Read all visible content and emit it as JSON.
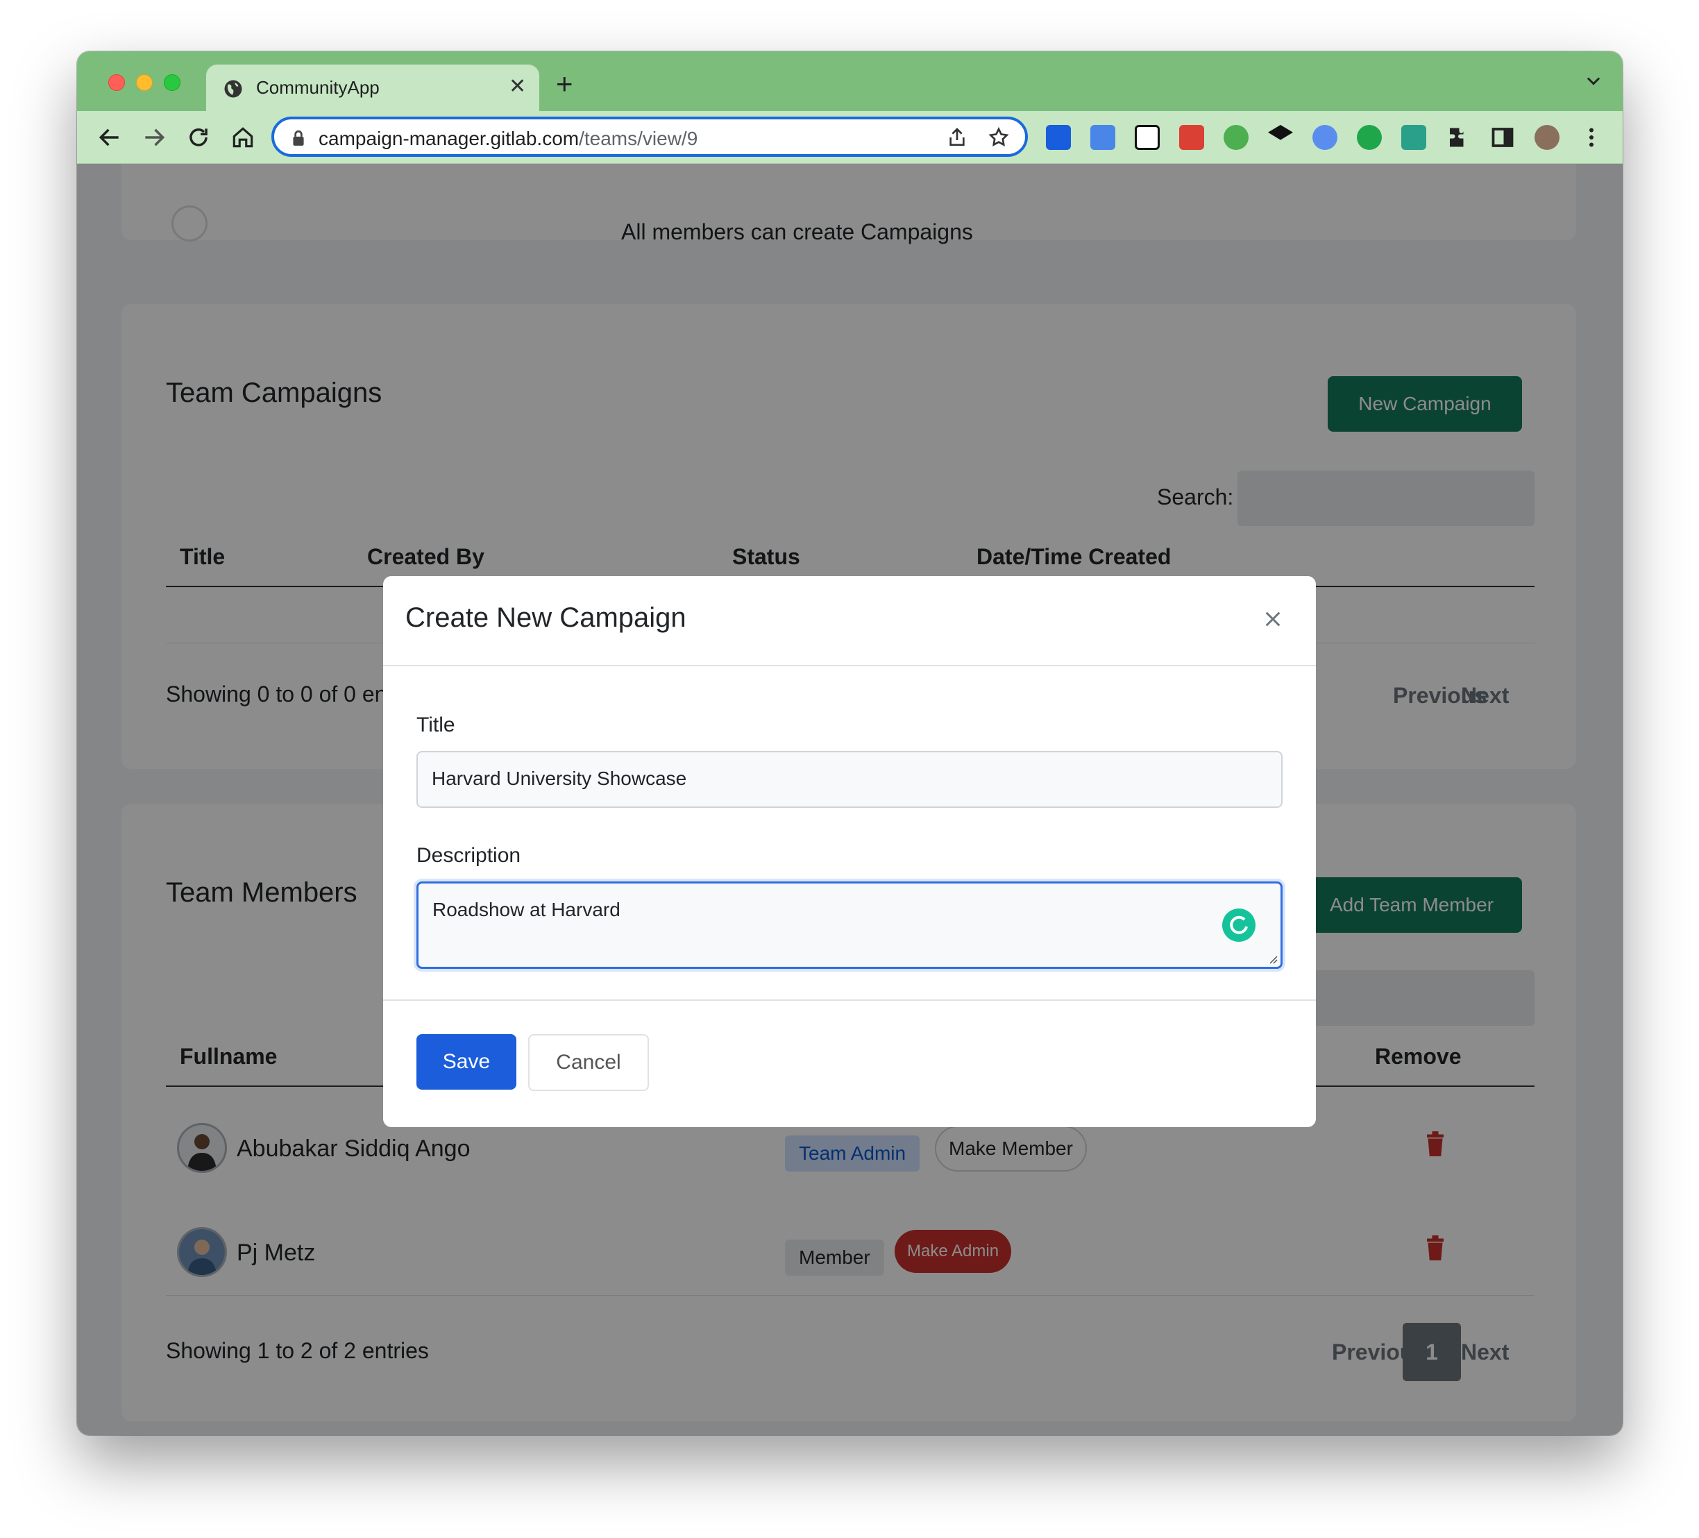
{
  "browser": {
    "tab_title": "CommunityApp",
    "url_host": "campaign-manager.gitlab.com",
    "url_path": "/teams/view/9"
  },
  "top_card": {
    "text": "All members can create Campaigns"
  },
  "campaigns": {
    "title": "Team Campaigns",
    "new_button": "New Campaign",
    "search_label": "Search:",
    "columns": [
      "Title",
      "Created By",
      "Status",
      "Date/Time Created"
    ],
    "info": "Showing 0 to 0 of 0 entries",
    "prev": "Previous",
    "next": "Next"
  },
  "members": {
    "title": "Team Members",
    "add_button": "Add Team Member",
    "col_fullname": "Fullname",
    "col_remove": "Remove",
    "rows": [
      {
        "name": "Abubakar Siddiq Ango",
        "role": "Team Admin",
        "action": "Make Member"
      },
      {
        "name": "Pj Metz",
        "role": "Member",
        "action": "Make Admin"
      }
    ],
    "info": "Showing 1 to 2 of 2 entries",
    "prev": "Previous",
    "page": "1",
    "next": "Next"
  },
  "modal": {
    "title": "Create New Campaign",
    "title_label": "Title",
    "title_value": "Harvard University Showcase",
    "desc_label": "Description",
    "desc_value": "Roadshow at Harvard",
    "save": "Save",
    "cancel": "Cancel"
  },
  "colors": {
    "tabstrip": "#7dbd7c",
    "primary_green": "#157a5b",
    "primary_blue": "#1b5ddb",
    "danger": "#c9302c"
  }
}
